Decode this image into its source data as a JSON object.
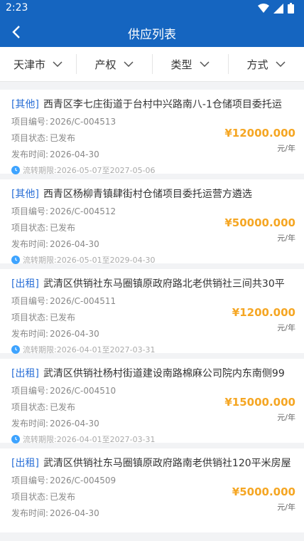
{
  "status": {
    "time": "2:23"
  },
  "header": {
    "title": "供应列表"
  },
  "filters": [
    {
      "label": "天津市"
    },
    {
      "label": "产权"
    },
    {
      "label": "类型"
    },
    {
      "label": "方式"
    }
  ],
  "labels": {
    "code": "项目编号:",
    "state": "项目状态:",
    "date": "发布时间:",
    "unit": "元/年"
  },
  "items": [
    {
      "tag": "[其他]",
      "title": "西青区李七庄街道于台村中兴路南八-1仓储项目委托运",
      "code": "2026/C-004513",
      "state": "已发布",
      "date": "2026-04-30",
      "price": "¥12000.000",
      "period": "流转期限:2026-05-07至2027-05-06"
    },
    {
      "tag": "[其他]",
      "title": "西青区杨柳青镇肆街村仓储项目委托运营方遴选",
      "code": "2026/C-004512",
      "state": "已发布",
      "date": "2026-04-30",
      "price": "¥50000.000",
      "period": "流转期限:2026-05-01至2029-04-30"
    },
    {
      "tag": "[出租]",
      "title": "武清区供销社东马圈镇原政府路北老供销社三间共30平",
      "code": "2026/C-004511",
      "state": "已发布",
      "date": "2026-04-30",
      "price": "¥1200.000",
      "period": "流转期限:2026-04-01至2027-03-31"
    },
    {
      "tag": "[出租]",
      "title": "武清区供销社杨村街道建设南路棉麻公司院内东南侧99",
      "code": "2026/C-004510",
      "state": "已发布",
      "date": "2026-04-30",
      "price": "¥15000.000",
      "period": "流转期限:2026-04-01至2027-03-31"
    },
    {
      "tag": "[出租]",
      "title": "武清区供销社东马圈镇原政府路南老供销社120平米房屋",
      "code": "2026/C-004509",
      "state": "已发布",
      "date": "2026-04-30",
      "price": "¥5000.000",
      "period": ""
    }
  ]
}
